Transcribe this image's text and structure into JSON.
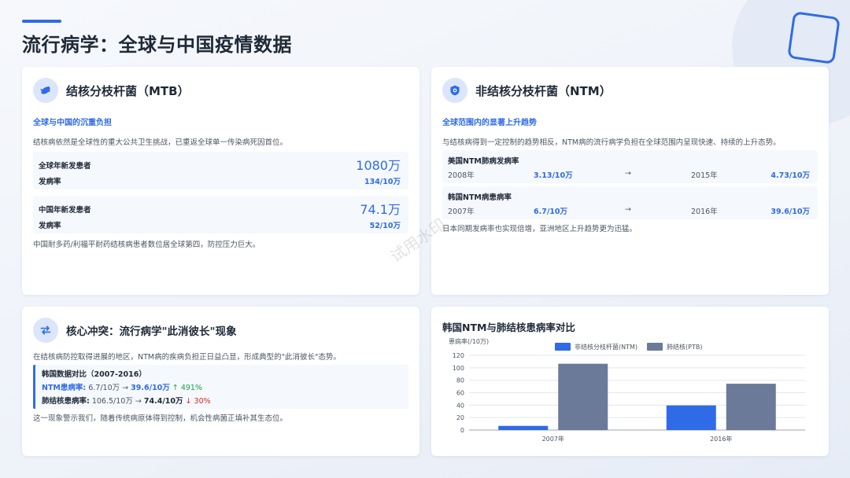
{
  "page_title": "流行病学：全球与中国疫情数据",
  "watermark": "试用水印",
  "mtb": {
    "title": "结核分枝杆菌（MTB）",
    "icon": "bacteria-icon",
    "subtitle": "全球与中国的沉重负担",
    "intro": "结核病依然是全球性的重大公共卫生挑战，已重返全球单一传染病死因首位。",
    "global": {
      "label": "全球年新发患者",
      "value": "1080万",
      "rate_label": "发病率",
      "rate": "134/10万"
    },
    "china": {
      "label": "中国年新发患者",
      "value": "74.1万",
      "rate_label": "发病率",
      "rate": "52/10万"
    },
    "note": "中国耐多药/利福平耐药结核病患者数位居全球第四，防控压力巨大。"
  },
  "ntm": {
    "title": "非结核分枝杆菌（NTM）",
    "icon": "shield-icon",
    "subtitle": "全球范围内的显著上升趋势",
    "intro": "与结核病得到一定控制的趋势相反，NTM病的流行病学负担在全球范围内呈现快速、持续的上升态势。",
    "rows": [
      {
        "title": "美国NTM肺病发病率",
        "y1": "2008年",
        "v1": "3.13/10万",
        "arrow": "→",
        "y2": "2015年",
        "v2": "4.73/10万"
      },
      {
        "title": "韩国NTM病患病率",
        "y1": "2007年",
        "v1": "6.7/10万",
        "arrow": "→",
        "y2": "2016年",
        "v2": "39.6/10万"
      }
    ],
    "note": "日本同期发病率也实现倍增，亚洲地区上升趋势更为迅猛。"
  },
  "conflict": {
    "title": "核心冲突：流行病学\"此消彼长\"现象",
    "icon": "swap-arrows-icon",
    "intro": "在结核病防控取得进展的地区，NTM病的疾病负担正日益凸显，形成典型的\"此消彼长\"态势。",
    "box_title": "韩国数据对比（2007-2016）",
    "ntm_label": "NTM患病率:",
    "ntm_from": "6.7/10万",
    "ntm_to": "39.6/10万",
    "ntm_change": "491%",
    "ptb_label": "肺结核患病率:",
    "ptb_from": "106.5/10万",
    "ptb_to": "74.4/10万",
    "ptb_change": "30%",
    "note": "这一现象警示我们，随着传统病原体得到控制，机会性病菌正填补其生态位。"
  },
  "chart_data": {
    "type": "bar",
    "title": "韩国NTM与肺结核患病率对比",
    "ylabel": "患病率(/10万)",
    "categories": [
      "2007年",
      "2016年"
    ],
    "series": [
      {
        "name": "非结核分枝杆菌(NTM)",
        "values": [
          6.7,
          39.6
        ],
        "color": "#2f6be6"
      },
      {
        "name": "肺结核(PTB)",
        "values": [
          106.5,
          74.4
        ],
        "color": "#6b7a99"
      }
    ],
    "yticks": [
      0,
      20,
      40,
      60,
      80,
      100,
      120
    ],
    "ylim": [
      0,
      120
    ],
    "grid": true,
    "legend": "top-center"
  },
  "colors": {
    "accent": "#2f6be6",
    "up": "#16a34a",
    "down": "#dc2626"
  }
}
